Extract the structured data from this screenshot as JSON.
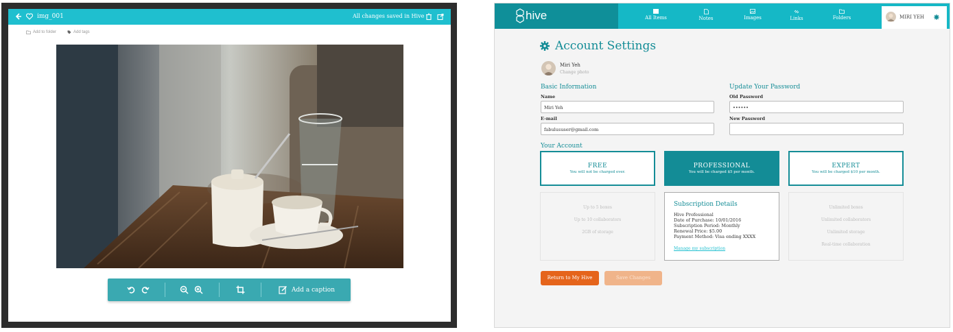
{
  "left": {
    "title": "img_001",
    "status": "All changes saved in Hive",
    "add_to_folder": "Add to folder",
    "add_tags": "Add tags",
    "caption_label": "Add a caption"
  },
  "right": {
    "brand": "hive",
    "nav": [
      {
        "label": "All Items",
        "icon": "grid-icon"
      },
      {
        "label": "Notes",
        "icon": "note-icon"
      },
      {
        "label": "Images",
        "icon": "image-icon"
      },
      {
        "label": "Links",
        "icon": "link-icon"
      },
      {
        "label": "Folders",
        "icon": "folder-icon"
      }
    ],
    "user_name": "MIRI YEH",
    "page_title": "Account Settings",
    "profile": {
      "name": "Miri Yeh",
      "change_photo": "Change photo"
    },
    "basic": {
      "title": "Basic Information",
      "name_label": "Name",
      "name_value": "Miri Yeh",
      "email_label": "E-mail",
      "email_value": "fabulususer@gmail.com"
    },
    "password": {
      "title": "Update Your Password",
      "old_label": "Old Password",
      "old_value": "••••••",
      "new_label": "New Password",
      "new_value": ""
    },
    "account_title": "Your Account",
    "plans": [
      {
        "name": "FREE",
        "desc": "You will not be charged ever."
      },
      {
        "name": "PROFESSIONAL",
        "desc": "You will be charged $5 per month."
      },
      {
        "name": "EXPERT",
        "desc": "You will be charged $10 per month."
      }
    ],
    "free_features": [
      "Up to 5 boxes",
      "Up to 10 collaborators",
      "2GB of storage"
    ],
    "expert_features": [
      "Unlimited boxes",
      "Unlimited collaborators",
      "Unlimited storage",
      "Real-time collaboration"
    ],
    "subscription": {
      "title": "Subscription Details",
      "lines": [
        "Hive Professional",
        "Date of Purchase:  10/01/2016",
        "Subscription Period:  Monthly",
        "Renewal Price:  $5.00",
        "Payment Method:  Visa ending XXXX"
      ],
      "manage_link": "Manage my subscription"
    },
    "return_button": "Return to My Hive",
    "save_button": "Save Changes"
  },
  "colors": {
    "teal": "#1fbfcf",
    "dark_teal": "#138c96",
    "orange": "#e5641b"
  }
}
